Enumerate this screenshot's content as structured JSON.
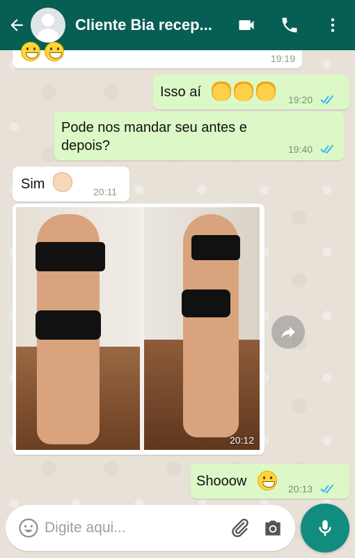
{
  "header": {
    "title": "Cliente Bia recep...",
    "back_icon": "arrow-left-icon",
    "video_icon": "video-call-icon",
    "call_icon": "phone-icon",
    "menu_icon": "more-vertical-icon"
  },
  "messages": [
    {
      "side": "incoming",
      "text": "",
      "time": "19:19",
      "emoji": "smiley-emoji-icon"
    },
    {
      "side": "outgoing",
      "text": "Isso aí",
      "time": "19:20",
      "emoji": "clapping-hands-icon",
      "status": "read"
    },
    {
      "side": "outgoing",
      "text": "Pode nos mandar seu antes e depois?",
      "time": "19:40",
      "status": "read"
    },
    {
      "side": "incoming",
      "text": "Sim",
      "time": "20:11",
      "emoji": "thumbs-up-icon"
    },
    {
      "side": "incoming",
      "type": "image",
      "time": "20:12",
      "image_desc": "before-after-photo"
    },
    {
      "side": "outgoing",
      "text": "Shooow",
      "time": "20:13",
      "emoji": "grinning-face-icon",
      "status": "read"
    }
  ],
  "input": {
    "placeholder": "Digite aqui..."
  },
  "colors": {
    "header": "#075e54",
    "outgoing_bubble": "#dcf8c6",
    "incoming_bubble": "#ffffff",
    "read_ticks": "#34b7f1",
    "mic_button": "#128c7e"
  }
}
